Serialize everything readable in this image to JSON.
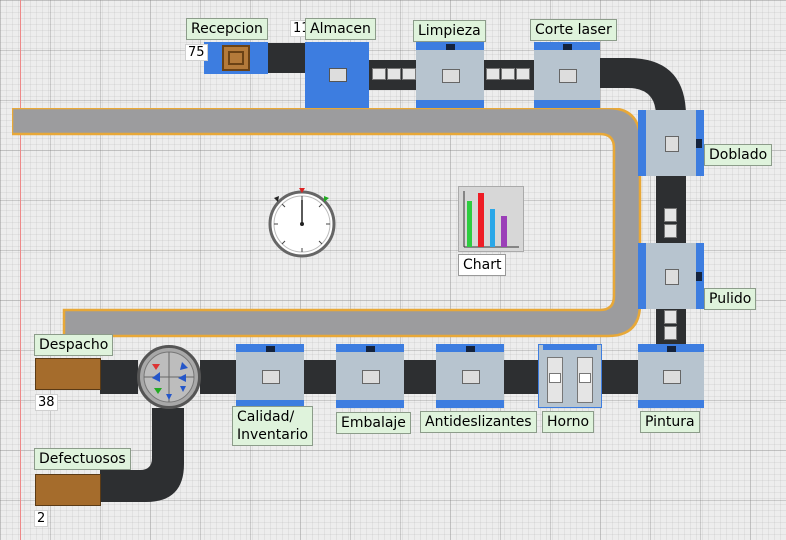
{
  "stations": {
    "recepcion": "Recepcion",
    "almacen": "Almacen",
    "limpieza": "Limpieza",
    "corte_laser": "Corte laser",
    "doblado": "Doblado",
    "pulido": "Pulido",
    "pintura": "Pintura",
    "horno": "Horno",
    "antideslizantes": "Antideslizantes",
    "embalaje": "Embalaje",
    "calidad_line1": "Calidad/",
    "calidad_line2": "Inventario",
    "despacho": "Despacho",
    "defectuosos": "Defectuosos"
  },
  "counts": {
    "recepcion": "75",
    "almacen": "11",
    "despacho": "38",
    "defectuosos": "2"
  },
  "widgets": {
    "chart_label": "Chart"
  },
  "colors": {
    "machine_blue": "#3d7de0",
    "conveyor": "#2d2f31",
    "track_border": "#e8a838",
    "label_bg": "#dff3dc"
  }
}
